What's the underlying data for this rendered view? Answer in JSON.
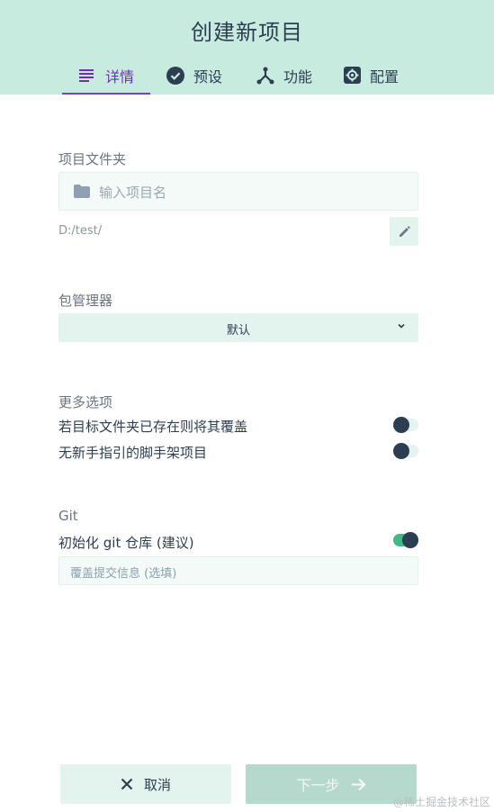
{
  "header": {
    "title": "创建新项目",
    "tabs": [
      {
        "label": "详情",
        "icon": "list-icon",
        "active": true
      },
      {
        "label": "预设",
        "icon": "check-circle-icon",
        "active": false
      },
      {
        "label": "功能",
        "icon": "fork-icon",
        "active": false
      },
      {
        "label": "配置",
        "icon": "gear-icon",
        "active": false
      }
    ]
  },
  "folder": {
    "label": "项目文件夹",
    "placeholder": "输入项目名",
    "icon": "folder-icon",
    "path": "D:/test/",
    "edit_icon": "pencil-icon"
  },
  "package_manager": {
    "label": "包管理器",
    "selected": "默认",
    "icon": "chevron-down-icon"
  },
  "more_options": {
    "label": "更多选项",
    "options": [
      {
        "label": "若目标文件夹已存在则将其覆盖",
        "enabled": false
      },
      {
        "label": "无新手指引的脚手架项目",
        "enabled": false
      }
    ]
  },
  "git": {
    "label": "Git",
    "init_label": "初始化 git 仓库 (建议)",
    "init_enabled": true,
    "commit_placeholder": "覆盖提交信息 (选填)"
  },
  "footer": {
    "cancel_label": "取消",
    "next_label": "下一步"
  },
  "watermark": "@稀土掘金技术社区",
  "colors": {
    "header_bg": "#c8ebe0",
    "accent_purple": "#6f2eb5",
    "toggle_on": "#42b983",
    "text_dark": "#2c3e50"
  }
}
